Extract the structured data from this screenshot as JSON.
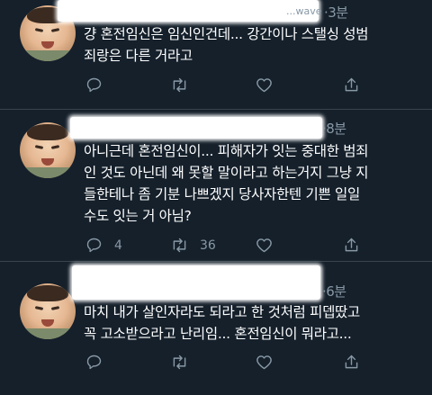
{
  "tweets": [
    {
      "handle_fragment": "...wave",
      "time": "·3분",
      "lines": [
        "걍 혼전임신은 임신인건데... 강간이나 스탤싱 성범",
        "죄랑은 다른 거라고"
      ],
      "reply_count": "",
      "retweet_count": "",
      "like_count": ""
    },
    {
      "handle_fragment": "",
      "time": "·8분",
      "lines": [
        "아니근데 혼전임신이... 피해자가 잇는 중대한 범죄",
        "인 것도 아닌데 왜 못할 말이라고 하는거지 그냥 지",
        "들한테나 좀 기분 나쁘겠지 당사자한텐 기쁜 일일",
        "수도 잇는 거 아님?"
      ],
      "reply_count": "4",
      "retweet_count": "36",
      "like_count": ""
    },
    {
      "handle_fragment": "",
      "time": "·6분",
      "lines": [
        "마치 내가 살인자라도 되라고 한 것처럼 피뎁땄고",
        "꼭 고소받으라고 난리임... 혼전임신이 뭐라고..."
      ],
      "reply_count": "",
      "retweet_count": "",
      "like_count": ""
    }
  ],
  "icons": {
    "reply": "reply-icon",
    "retweet": "retweet-icon",
    "like": "heart-icon",
    "share": "share-icon"
  },
  "colors": {
    "background": "#15202b",
    "muted": "#8899a6",
    "divider": "#38444d"
  }
}
